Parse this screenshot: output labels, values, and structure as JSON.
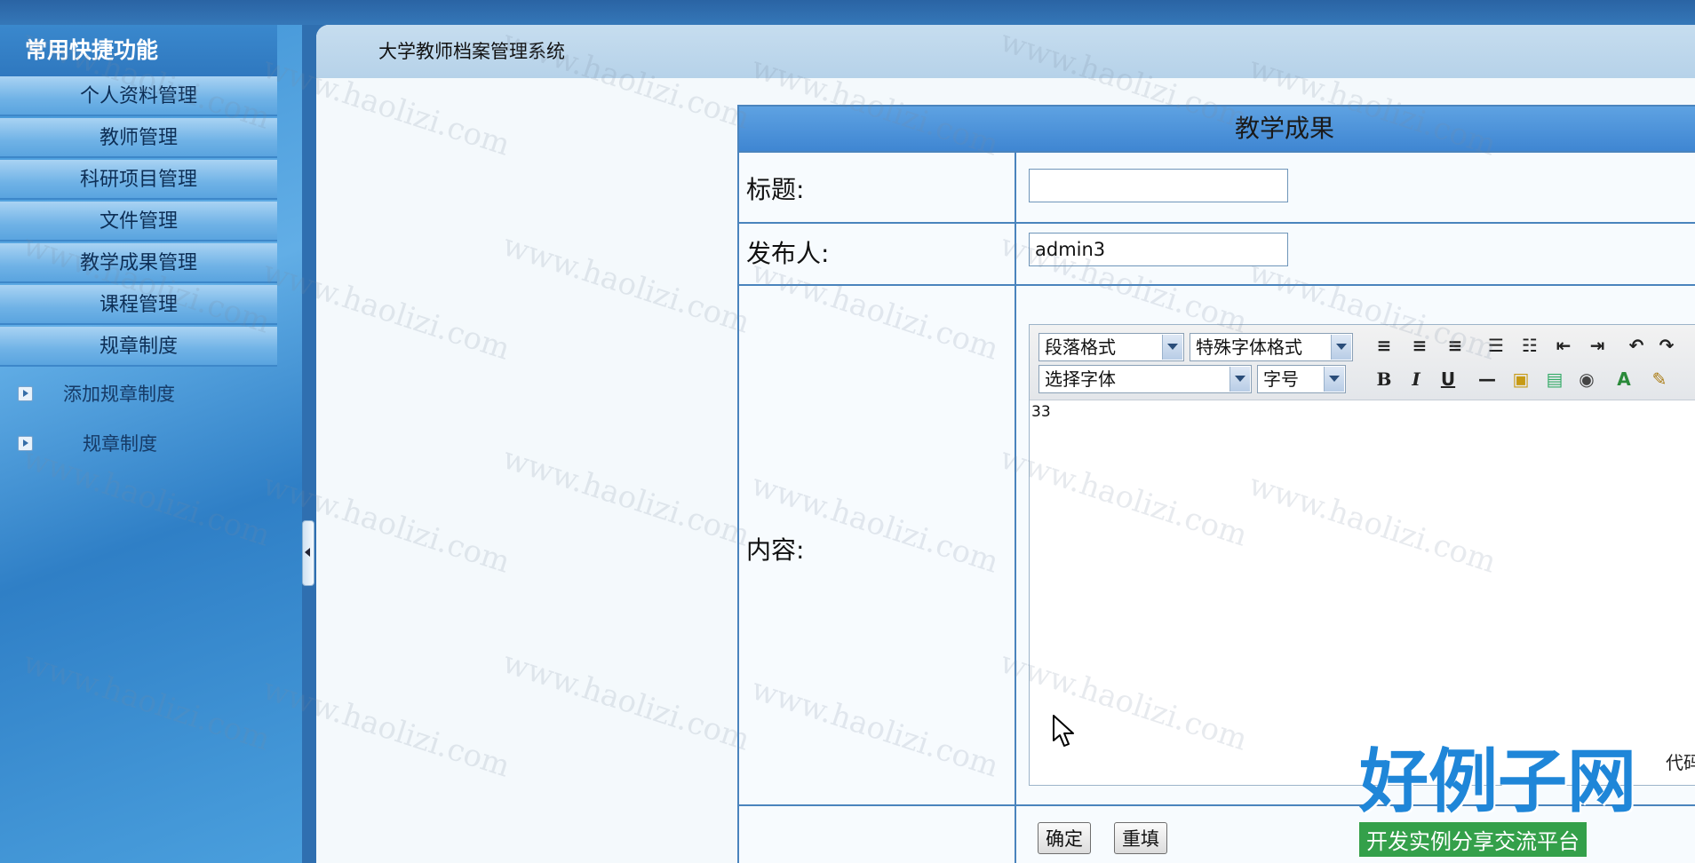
{
  "sidebar": {
    "title": "常用快捷功能",
    "items": [
      {
        "label": "个人资料管理"
      },
      {
        "label": "教师管理"
      },
      {
        "label": "科研项目管理"
      },
      {
        "label": "文件管理"
      },
      {
        "label": "教学成果管理"
      },
      {
        "label": "课程管理"
      },
      {
        "label": "规章制度"
      }
    ],
    "sub_items": [
      {
        "label": "添加规章制度"
      },
      {
        "label": "规章制度"
      }
    ]
  },
  "header": {
    "system_title": "大学教师档案管理系统"
  },
  "form": {
    "heading": "教学成果",
    "title_label": "标题:",
    "title_value": "",
    "publisher_label": "发布人:",
    "publisher_value": "admin3",
    "content_label": "内容:",
    "editor": {
      "paragraph_format": "段落格式",
      "special_format": "特殊字体格式",
      "font_select": "选择字体",
      "font_size": "字号",
      "body_text": "33",
      "footer_text": "代码"
    },
    "confirm_label": "确定",
    "reset_label": "重填"
  },
  "watermark": {
    "text": "www.haolizi.com"
  },
  "brand": {
    "title": "好例子网",
    "subtitle": "开发实例分享交流平台"
  }
}
